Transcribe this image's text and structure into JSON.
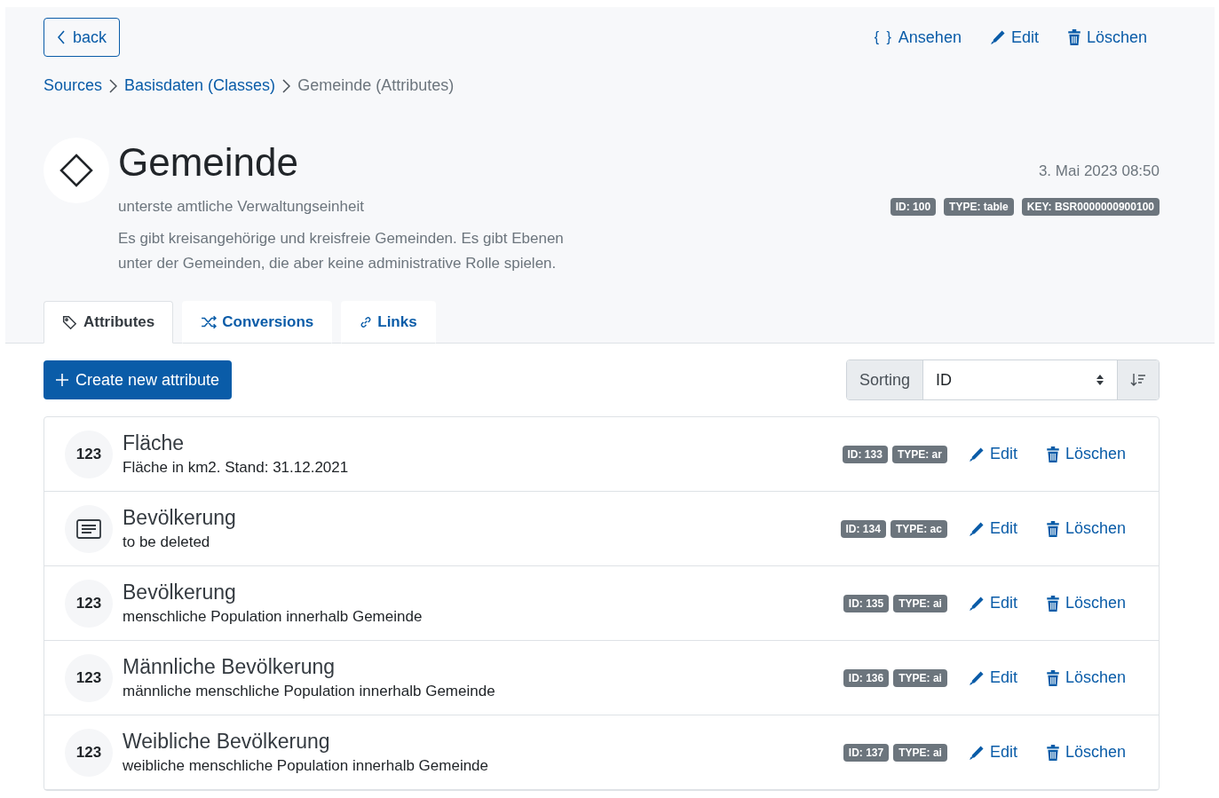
{
  "back_button": {
    "label": "back"
  },
  "header_actions": [
    {
      "kind": "view",
      "label": "Ansehen",
      "icon_text": "{ }"
    },
    {
      "kind": "edit",
      "label": "Edit"
    },
    {
      "kind": "delete",
      "label": "Löschen"
    }
  ],
  "breadcrumb": [
    {
      "label": "Sources",
      "current": false
    },
    {
      "label": "Basisdaten (Classes)",
      "current": false
    },
    {
      "label": "Gemeinde (Attributes)",
      "current": true
    }
  ],
  "title": "Gemeinde",
  "subtitle": "unterste amtliche Verwaltungseinheit",
  "description": "Es gibt kreisangehörige und kreisfreie Gemeinden. Es gibt Ebenen unter der Gemeinden, die aber keine administrative Rolle spielen.",
  "timestamp": "3. Mai 2023 08:50",
  "badges": [
    "ID: 100",
    "TYPE: table",
    "KEY: BSR0000000900100"
  ],
  "tabs": [
    {
      "kind": "tag",
      "label": "Attributes",
      "selected": true
    },
    {
      "kind": "shuffle",
      "label": "Conversions",
      "selected": false
    },
    {
      "kind": "link",
      "label": "Links",
      "selected": false
    }
  ],
  "create_button": {
    "label": "Create new attribute"
  },
  "sorting": {
    "label": "Sorting",
    "value": "ID"
  },
  "attributes": [
    {
      "kind": "number",
      "symbol": "123",
      "name": "Fläche",
      "description": "Fläche in km2. Stand: 31.12.2021",
      "badges": [
        "ID: 133",
        "TYPE: ar"
      ],
      "edit": "Edit",
      "delete": "Löschen"
    },
    {
      "kind": "text",
      "name": "Bevölkerung",
      "description": "to be deleted",
      "badges": [
        "ID: 134",
        "TYPE: ac"
      ],
      "edit": "Edit",
      "delete": "Löschen"
    },
    {
      "kind": "number",
      "symbol": "123",
      "name": "Bevölkerung",
      "description": "menschliche Population innerhalb Gemeinde",
      "badges": [
        "ID: 135",
        "TYPE: ai"
      ],
      "edit": "Edit",
      "delete": "Löschen"
    },
    {
      "kind": "number",
      "symbol": "123",
      "name": "Männliche Bevölkerung",
      "description": "männliche menschliche Population innerhalb Gemeinde",
      "badges": [
        "ID: 136",
        "TYPE: ai"
      ],
      "edit": "Edit",
      "delete": "Löschen"
    },
    {
      "kind": "number",
      "symbol": "123",
      "name": "Weibliche Bevölkerung",
      "description": "weibliche menschliche Population innerhalb Gemeinde",
      "badges": [
        "ID: 137",
        "TYPE: ai"
      ],
      "edit": "Edit",
      "delete": "Löschen"
    }
  ]
}
